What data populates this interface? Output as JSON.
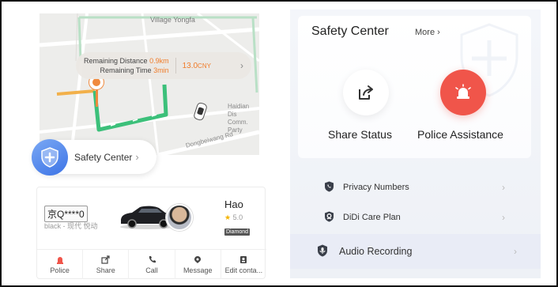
{
  "map": {
    "village_label": "Village Yongfa",
    "haidian_label_1": "Haidian Dis",
    "haidian_label_2": "Comm. Party",
    "road_label": "Dongbeiwang Rd",
    "trip": {
      "distance_label": "Remaining Distance",
      "distance_value": "0.9km",
      "time_label": "Remaining Time",
      "time_value": "3min",
      "fare_value": "13.0",
      "fare_unit": "CNY"
    }
  },
  "safety_pill": {
    "label": "Safety Center",
    "icon": "shield-plus-icon"
  },
  "driver_card": {
    "plate": "京Q****0",
    "car_meta": "black - 现代 悦动",
    "driver_name": "Hao",
    "rating": "5.0",
    "badge": "Diamond",
    "actions": [
      {
        "label": "Police",
        "icon": "police-light-icon"
      },
      {
        "label": "Share",
        "icon": "share-icon"
      },
      {
        "label": "Call",
        "icon": "phone-icon"
      },
      {
        "label": "Message",
        "icon": "message-icon"
      },
      {
        "label": "Edit conta...",
        "icon": "edit-contact-icon"
      }
    ]
  },
  "safety_center": {
    "title": "Safety Center",
    "more_label": "More",
    "share_status_label": "Share Status",
    "police_assistance_label": "Police Assistance",
    "rows": [
      {
        "label": "Privacy Numbers",
        "icon": "shield-phone-icon"
      },
      {
        "label": "DiDi Care Plan",
        "icon": "care-plan-icon"
      },
      {
        "label": "Audio Recording",
        "icon": "audio-shield-icon"
      }
    ]
  },
  "colors": {
    "accent_orange": "#f07c2a",
    "route_green": "#3cc07a",
    "police_red": "#f0554a",
    "shield_blue": "#3d74e6"
  }
}
